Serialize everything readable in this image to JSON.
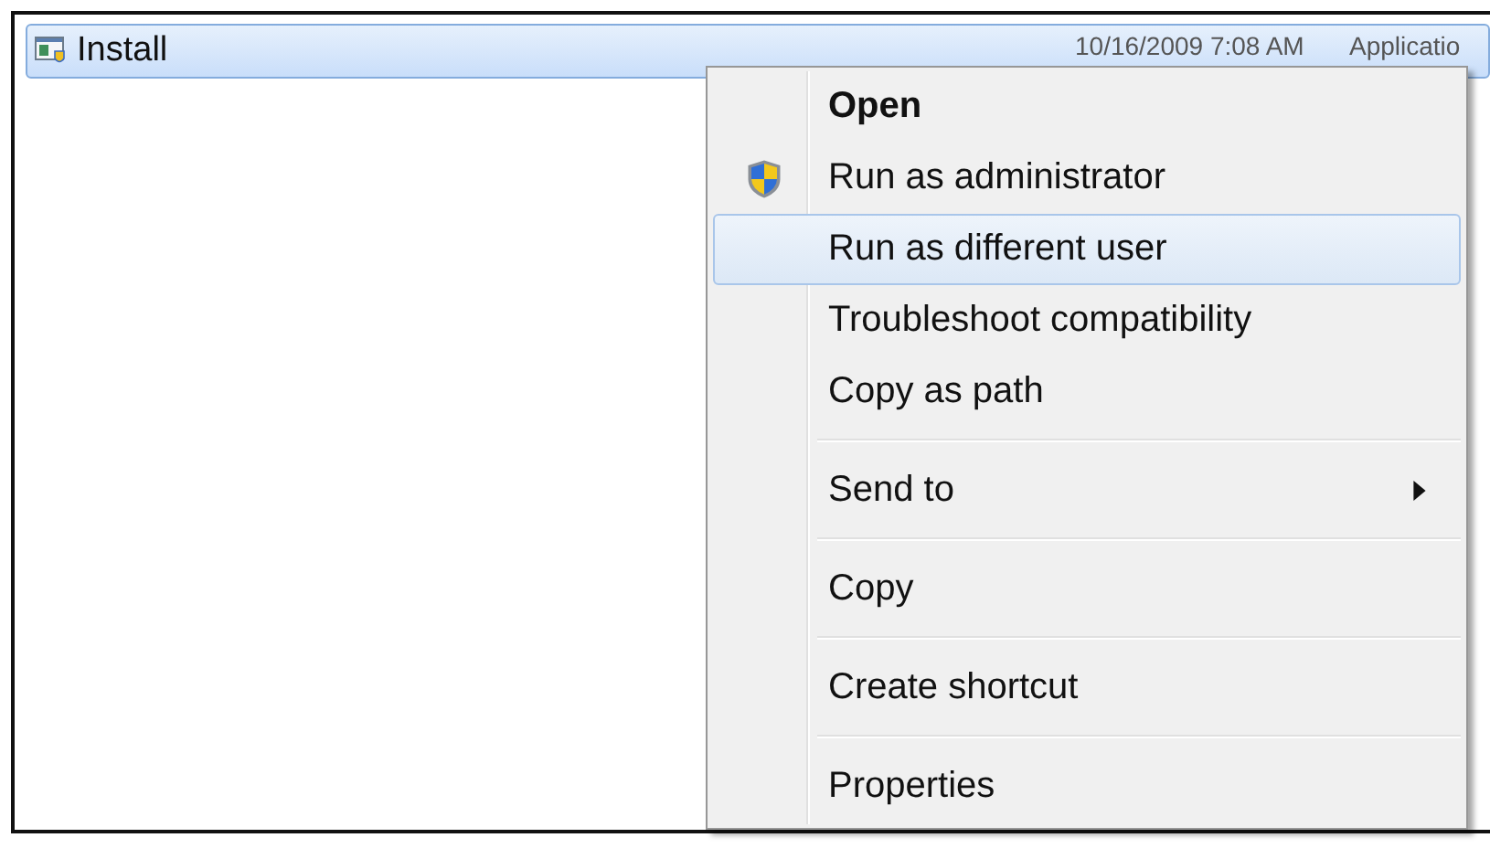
{
  "file_row": {
    "name": "Install",
    "selected": true,
    "date": "10/16/2009 7:08 AM",
    "type": "Applicatio"
  },
  "context_menu": {
    "items": [
      {
        "kind": "item",
        "label": "Open",
        "default": true,
        "selected": false
      },
      {
        "kind": "shield_item",
        "label": "Run as administrator",
        "default": false,
        "selected": false
      },
      {
        "kind": "item",
        "label": "Run as different user",
        "default": false,
        "selected": true
      },
      {
        "kind": "item",
        "label": "Troubleshoot compatibility",
        "default": false,
        "selected": false
      },
      {
        "kind": "item",
        "label": "Copy as path",
        "default": false,
        "selected": false
      },
      {
        "kind": "separator"
      },
      {
        "kind": "item",
        "label": "Send to",
        "default": false,
        "selected": false,
        "submenu": true
      },
      {
        "kind": "separator"
      },
      {
        "kind": "item",
        "label": "Copy",
        "default": false,
        "selected": false
      },
      {
        "kind": "separator"
      },
      {
        "kind": "item",
        "label": "Create shortcut",
        "default": false,
        "selected": false
      },
      {
        "kind": "separator"
      },
      {
        "kind": "item",
        "label": "Properties",
        "default": false,
        "selected": false
      }
    ]
  }
}
